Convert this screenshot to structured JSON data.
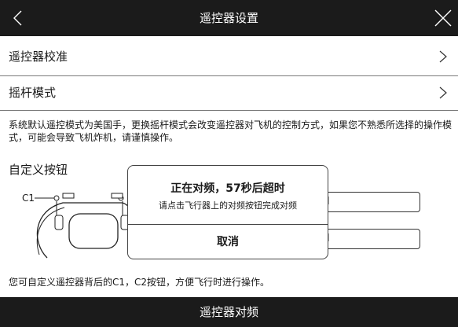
{
  "header": {
    "title": "遥控器设置",
    "back_icon": "chevron-left-icon",
    "close_icon": "close-icon"
  },
  "settings": {
    "calibration_label": "遥控器校准",
    "stick_mode_label": "摇杆模式",
    "description": "系统默认遥控模式为美国手，更换摇杆模式会改变遥控器对飞机的控制方式，如果您不熟悉所选择的操作模式，可能会导致飞机炸机，请谨慎操作。"
  },
  "custom_buttons": {
    "title": "自定义按钮",
    "c1_label": "C1",
    "field1_value": "l",
    "field2_value": "l",
    "footnote": "您可自定义遥控器背后的C1，C2按钮，方便飞行时进行操作。"
  },
  "dialog": {
    "title": "正在对频，57秒后超时",
    "message": "请点击飞行器上的对频按钮完成对频",
    "cancel_label": "取消"
  },
  "bottom_bar": {
    "label": "遥控器对频"
  },
  "colors": {
    "bar_background": "#1b1b1b",
    "page_background": "#ffffff",
    "divider": "#7a7a7a"
  }
}
